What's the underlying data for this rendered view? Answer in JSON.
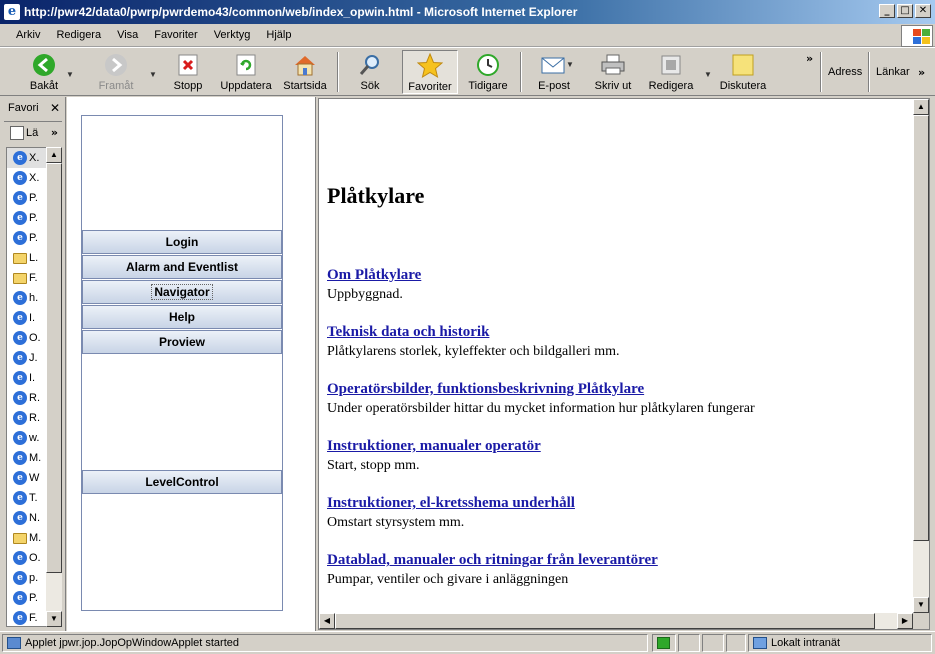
{
  "window": {
    "title": "http://pwr42/data0/pwrp/pwrdemo43/common/web/index_opwin.html - Microsoft Internet Explorer",
    "controls": [
      "_",
      "□",
      "✕"
    ]
  },
  "menu": [
    "Arkiv",
    "Redigera",
    "Visa",
    "Favoriter",
    "Verktyg",
    "Hjälp"
  ],
  "toolbar": {
    "back": "Bakåt",
    "forward": "Framåt",
    "stop": "Stopp",
    "refresh": "Uppdatera",
    "home": "Startsida",
    "search": "Sök",
    "favorites": "Favoriter",
    "history": "Tidigare",
    "mail": "E-post",
    "print": "Skriv ut",
    "edit": "Redigera",
    "discuss": "Diskutera",
    "address": "Adress",
    "links": "Länkar",
    "chevron": "»"
  },
  "favorites_pane": {
    "title": "Favori",
    "tool_label": "Lä",
    "items": [
      {
        "label": "X.",
        "type": "ie"
      },
      {
        "label": "X.",
        "type": "ie"
      },
      {
        "label": "P.",
        "type": "ie"
      },
      {
        "label": "P.",
        "type": "ie"
      },
      {
        "label": "P.",
        "type": "ie"
      },
      {
        "label": "L.",
        "type": "folder"
      },
      {
        "label": "F.",
        "type": "folder"
      },
      {
        "label": "h.",
        "type": "ie"
      },
      {
        "label": "I.",
        "type": "ie"
      },
      {
        "label": "O.",
        "type": "ie"
      },
      {
        "label": "J.",
        "type": "ie"
      },
      {
        "label": "I.",
        "type": "ie"
      },
      {
        "label": "R.",
        "type": "ie"
      },
      {
        "label": "R.",
        "type": "ie"
      },
      {
        "label": "w.",
        "type": "ie"
      },
      {
        "label": "M.",
        "type": "ie"
      },
      {
        "label": "W",
        "type": "ie"
      },
      {
        "label": "T.",
        "type": "ie"
      },
      {
        "label": "N.",
        "type": "ie"
      },
      {
        "label": "M.",
        "type": "folder"
      },
      {
        "label": "O.",
        "type": "ie"
      },
      {
        "label": "p.",
        "type": "ie"
      },
      {
        "label": "P.",
        "type": "ie"
      },
      {
        "label": "F.",
        "type": "ie"
      }
    ]
  },
  "applet": {
    "buttons": [
      "Login",
      "Alarm and Eventlist",
      "Navigator",
      "Help",
      "Proview"
    ],
    "level_button": "LevelControl"
  },
  "content": {
    "heading": "Plåtkylare",
    "entries": [
      {
        "link": "Om Plåtkylare",
        "desc": "Uppbyggnad."
      },
      {
        "link": "Teknisk data och historik",
        "desc": "Plåtkylarens storlek, kyleffekter och bildgalleri mm."
      },
      {
        "link": "Operatörsbilder, funktionsbeskrivning Plåtkylare",
        "desc": "Under operatörsbilder hittar du mycket information hur plåtkylaren fungerar"
      },
      {
        "link": "Instruktioner, manualer operatör",
        "desc": "Start, stopp mm."
      },
      {
        "link": "Instruktioner, el-kretsshema underhåll",
        "desc": "Omstart styrsystem mm."
      },
      {
        "link": "Datablad, manualer och ritningar från leverantörer",
        "desc": "Pumpar, ventiler och givare i anläggningen"
      }
    ]
  },
  "status": {
    "text": "Applet jpwr.jop.JopOpWindowApplet started",
    "zone": "Lokalt intranät"
  },
  "colors": {
    "link": "#1a1aa6",
    "titlebar": "#0a246a"
  }
}
